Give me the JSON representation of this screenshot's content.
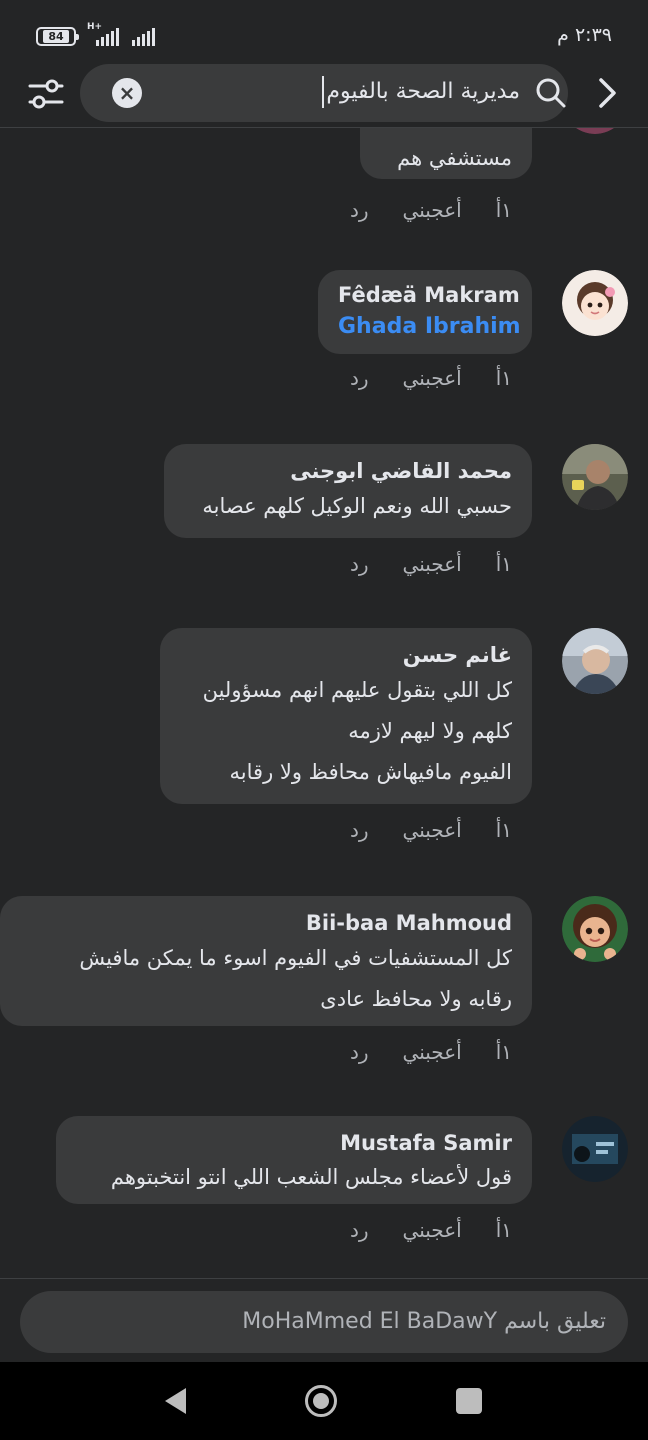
{
  "status_bar": {
    "battery": "84",
    "network": "H+",
    "time": "٢:٣٩ م"
  },
  "search": {
    "value": "مديرية الصحة بالفيوم"
  },
  "comments": [
    {
      "author": "",
      "lines": [
        "مستشفي هم"
      ],
      "time": "١أ",
      "like": "أعجبني",
      "reply": "رد"
    },
    {
      "author": "Fêdæä Makram",
      "mention": "Ghada Ibrahim",
      "lines": [],
      "time": "١أ",
      "like": "أعجبني",
      "reply": "رد"
    },
    {
      "author": "محمد القاضي ابوجنى",
      "lines": [
        "حسبي الله ونعم الوكيل كلهم عصابه"
      ],
      "time": "١أ",
      "like": "أعجبني",
      "reply": "رد"
    },
    {
      "author": "غانم حسن",
      "lines": [
        "كل اللي بتقول عليهم انهم مسؤولين",
        "كلهم ولا ليهم لازمه",
        "الفيوم مافيهاش محافظ ولا رقابه"
      ],
      "time": "١أ",
      "like": "أعجبني",
      "reply": "رد"
    },
    {
      "author": "Bii-baa Mahmoud",
      "lines": [
        "كل المستشفيات في الفيوم اسوء ما يمكن مافيش",
        "رقابه ولا محافظ عادى"
      ],
      "time": "١أ",
      "like": "أعجبني",
      "reply": "رد"
    },
    {
      "author": "Mustafa Samir",
      "lines": [
        "قول لأعضاء مجلس الشعب اللي انتو انتخبتوهم"
      ],
      "time": "١أ",
      "like": "أعجبني",
      "reply": "رد"
    }
  ],
  "composer": {
    "placeholder": "تعليق باسم MoHaMmed El BaDawY"
  }
}
